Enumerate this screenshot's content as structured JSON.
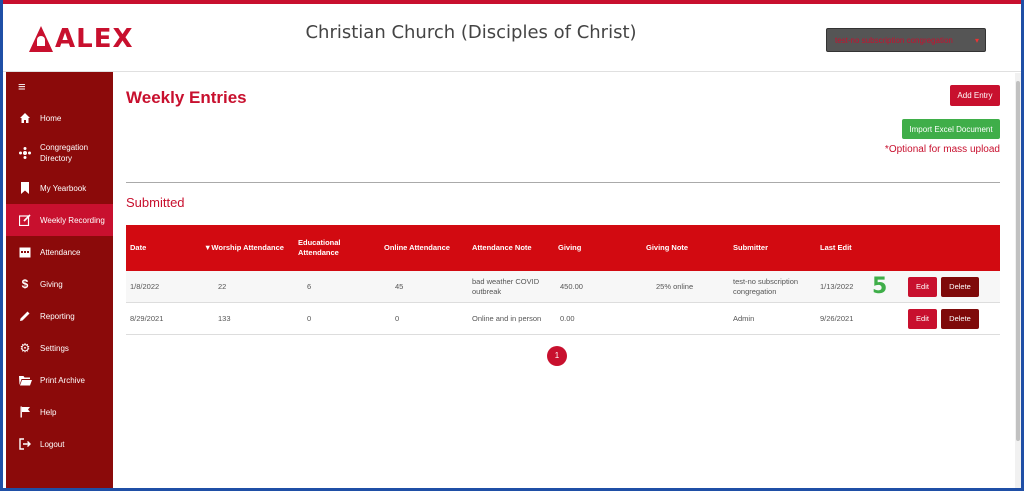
{
  "colors": {
    "brand_red": "#c8102e",
    "sidebar": "#8b0a0a",
    "green": "#3fae49",
    "delete": "#7f0a0a"
  },
  "header": {
    "logo_text": "ALEX",
    "church_name": "Christian Church (Disciples of Christ)",
    "account_label": "test-no subscription congregation"
  },
  "sidebar": {
    "toggle_icon": "hamburger-icon",
    "items": [
      {
        "label": "Home",
        "icon": "home-icon"
      },
      {
        "label": "Congregation Directory",
        "icon": "directory-icon"
      },
      {
        "label": "My Yearbook",
        "icon": "bookmark-icon"
      },
      {
        "label": "Weekly Recording",
        "icon": "edit-icon",
        "active": true
      },
      {
        "label": "Attendance",
        "icon": "calendar-icon"
      },
      {
        "label": "Giving",
        "icon": "dollar-icon"
      },
      {
        "label": "Reporting",
        "icon": "pencil-icon"
      },
      {
        "label": "Settings",
        "icon": "gear-icon"
      },
      {
        "label": "Print Archive",
        "icon": "folder-icon"
      },
      {
        "label": "Help",
        "icon": "flag-icon"
      },
      {
        "label": "Logout",
        "icon": "logout-icon"
      }
    ]
  },
  "main": {
    "title": "Weekly Entries",
    "add_entry_label": "Add Entry",
    "import_label": "Import Excel Document",
    "optional_note": "*Optional for mass upload",
    "section_title": "Submitted",
    "columns": {
      "date": "Date",
      "worship": "▼Worship Attendance",
      "educational": "Educational Attendance",
      "online": "Online Attendance",
      "note": "Attendance Note",
      "giving": "Giving",
      "giving_note": "Giving Note",
      "submitter": "Submitter",
      "last_edit": "Last Edit"
    },
    "rows": [
      {
        "date": "1/8/2022",
        "worship": "22",
        "educational": "6",
        "online": "45",
        "note": "bad weather COVID outbreak",
        "giving": "450.00",
        "giving_note": "25% online",
        "submitter": "test-no subscription congregation",
        "last_edit": "1/13/2022",
        "badge": "5",
        "edit_label": "Edit",
        "delete_label": "Delete"
      },
      {
        "date": "8/29/2021",
        "worship": "133",
        "educational": "0",
        "online": "0",
        "note": "Online and in person",
        "giving": "0.00",
        "giving_note": "",
        "submitter": "Admin",
        "last_edit": "9/26/2021",
        "badge": "",
        "edit_label": "Edit",
        "delete_label": "Delete"
      }
    ],
    "pager": {
      "current_page": "1"
    }
  }
}
